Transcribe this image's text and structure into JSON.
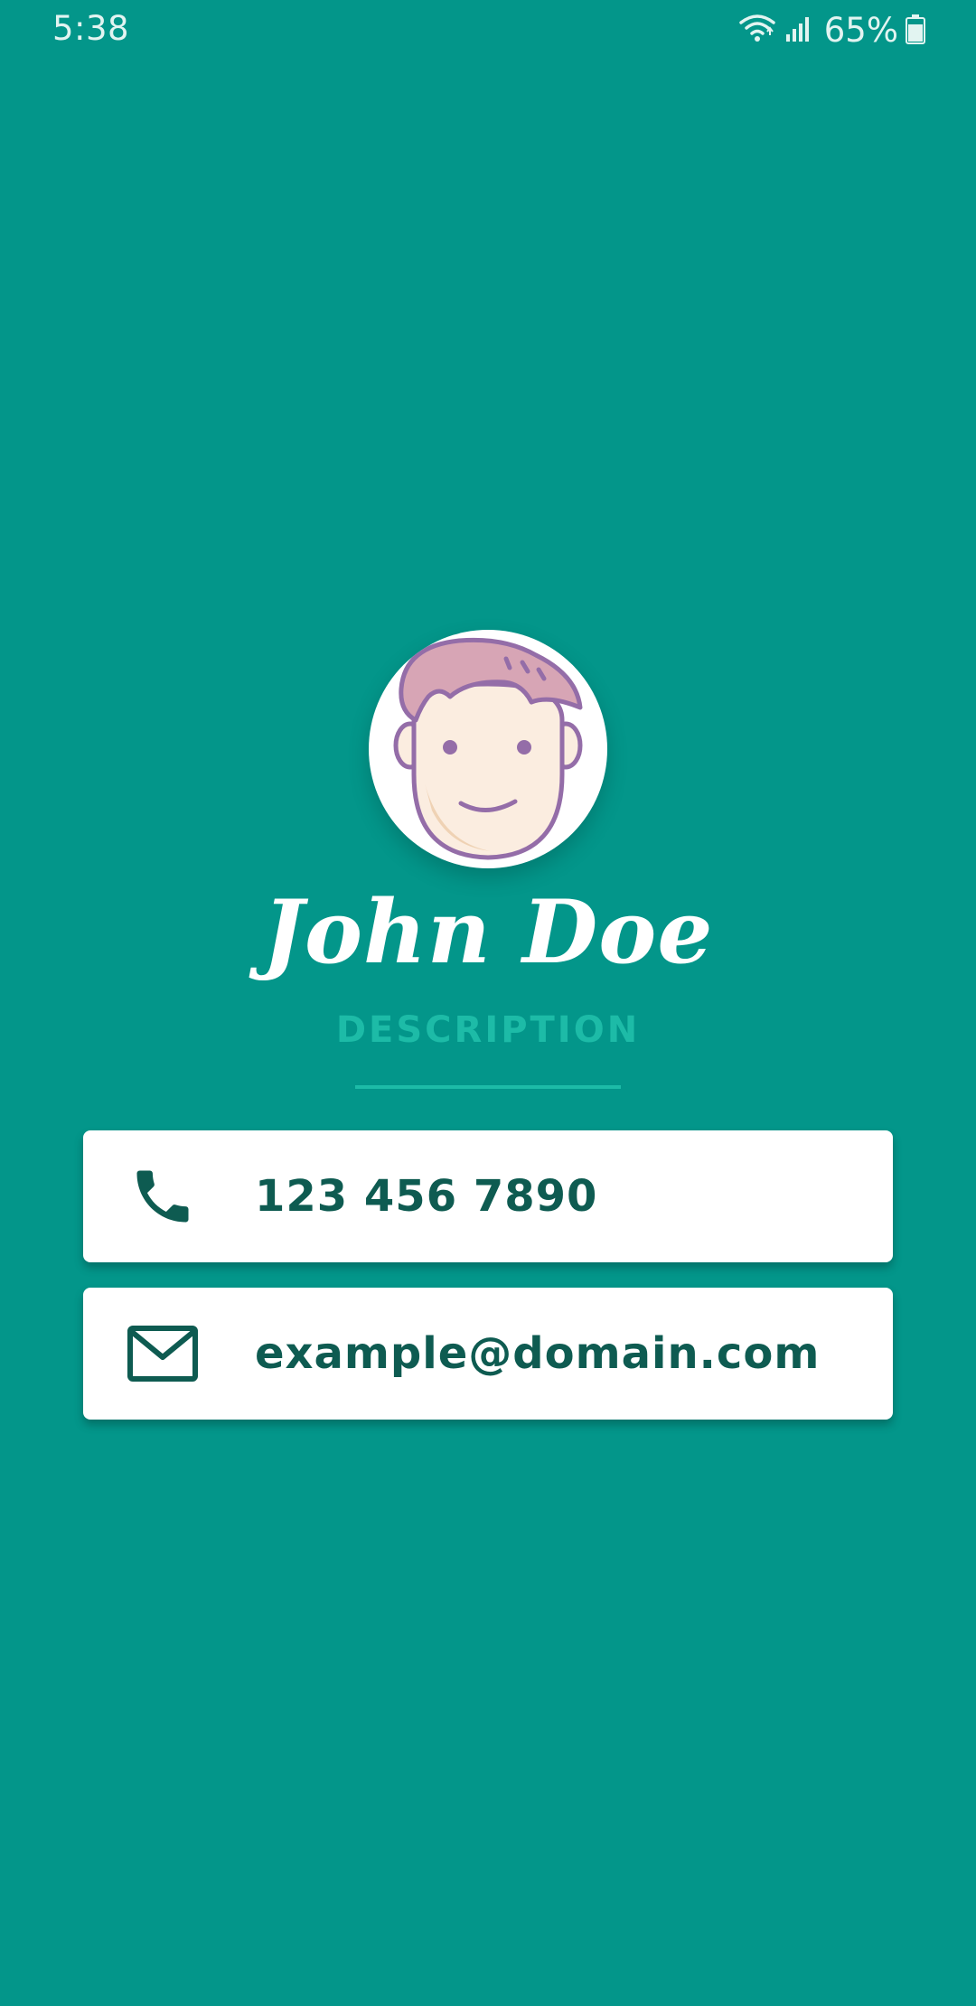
{
  "status_bar": {
    "time": "5:38",
    "battery": "65%",
    "icons": [
      "wifi-icon",
      "signal-icon",
      "battery-icon"
    ]
  },
  "profile": {
    "avatar_icon": "avatar-face-icon",
    "name": "John Doe",
    "description": "DESCRIPTION"
  },
  "contacts": {
    "phone": {
      "icon": "phone-icon",
      "value": "123 456 7890"
    },
    "email": {
      "icon": "mail-icon",
      "value": "example@domain.com"
    }
  },
  "colors": {
    "background": "#03968A",
    "accent": "#1DBBA7",
    "text_dark": "#0E5B51",
    "card": "#FFFFFF"
  }
}
